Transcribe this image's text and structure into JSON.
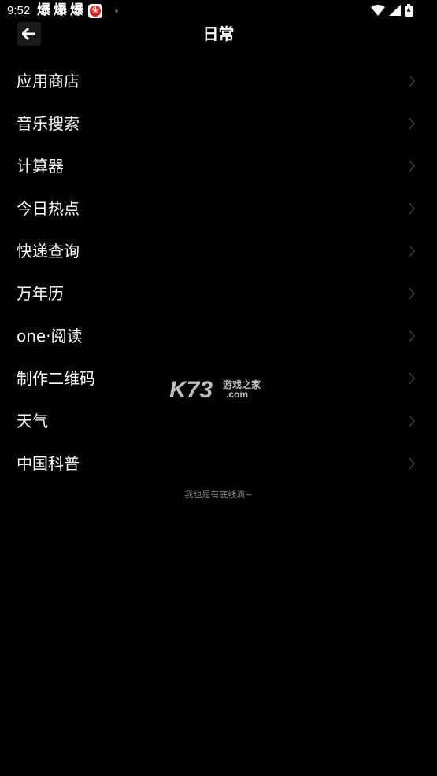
{
  "status_bar": {
    "time": "9:52",
    "notification_glyphs": [
      "爆",
      "爆",
      "爆"
    ],
    "app_badge_text": "头",
    "icons": [
      "wifi-icon",
      "signal-icon",
      "battery-icon"
    ]
  },
  "header": {
    "title": "日常",
    "back_icon": "arrow-left-icon"
  },
  "menu": {
    "items": [
      {
        "label": "应用商店"
      },
      {
        "label": "音乐搜索"
      },
      {
        "label": "计算器"
      },
      {
        "label": "今日热点"
      },
      {
        "label": "快递查询"
      },
      {
        "label": "万年历"
      },
      {
        "label": "one·阅读"
      },
      {
        "label": "制作二维码"
      },
      {
        "label": "天气"
      },
      {
        "label": "中国科普"
      }
    ],
    "chevron_icon": "chevron-right-icon"
  },
  "footer": {
    "note": "我也是有底线滴~"
  },
  "watermark": {
    "brand": "K73",
    "sub_top": "游戏之家",
    "sub_bottom": ".com"
  },
  "colors": {
    "background": "#000000",
    "text": "#ffffff",
    "chevron": "#3a3a3a",
    "footer_text": "#8a8a8a"
  }
}
